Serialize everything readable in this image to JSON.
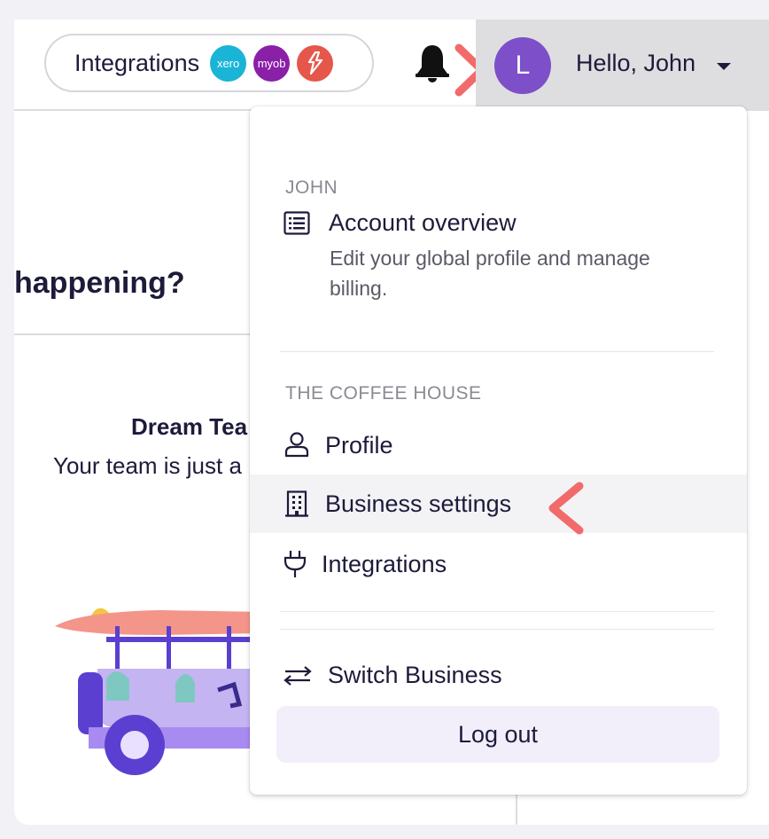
{
  "topbar": {
    "integrations_label": "Integrations",
    "integration_logos": [
      {
        "name": "xero",
        "text": "xero",
        "color": "#1ab4d7"
      },
      {
        "name": "myob",
        "text": "myob",
        "color": "#8a1fa8"
      },
      {
        "name": "lightspeed",
        "text": "",
        "color": "#e5574a"
      }
    ],
    "notifications_icon": "bell-icon",
    "avatar_initial": "L",
    "greeting": "Hello, John"
  },
  "page": {
    "heading_partial": "happening?",
    "card_title_partial": "Dream Tea",
    "card_subtitle_partial": "Your team is just a"
  },
  "dropdown": {
    "user_section_label": "JOHN",
    "account_overview": {
      "label": "Account overview",
      "description": "Edit your global profile and manage billing.",
      "icon": "list-icon"
    },
    "business_section_label": "THE COFFEE HOUSE",
    "items": [
      {
        "label": "Profile",
        "icon": "user-icon"
      },
      {
        "label": "Business settings",
        "icon": "building-icon",
        "highlighted": true
      },
      {
        "label": "Integrations",
        "icon": "plug-icon"
      }
    ],
    "switch_business": {
      "label": "Switch Business",
      "icon": "switch-arrows-icon"
    },
    "logout_label": "Log out"
  },
  "annotations": {
    "arrow_color": "#f26b6b"
  },
  "colors": {
    "avatar": "#7d4fc8",
    "highlight_row": "#f3f3f6",
    "logout_bg": "#f2effb",
    "text": "#1d1b3a"
  }
}
